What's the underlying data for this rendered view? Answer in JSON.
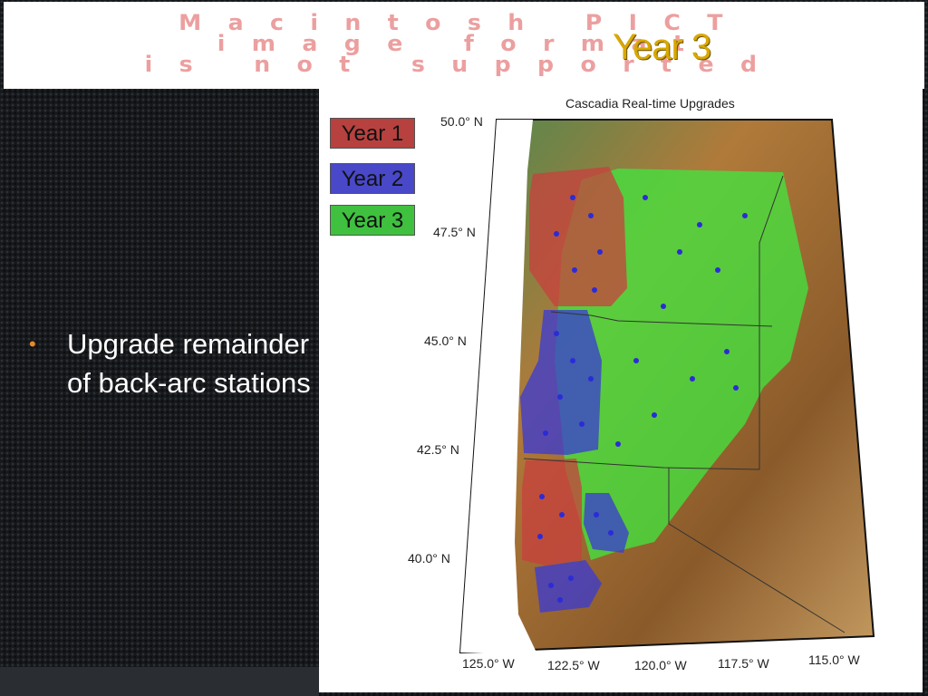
{
  "banner": {
    "pict_line1": "Macintosh PICT",
    "pict_line2": "image format",
    "pict_line3": "is not supported"
  },
  "slide": {
    "title": "Year 3",
    "bullet": "Upgrade remainder of back-arc stations"
  },
  "map": {
    "title": "Cascadia Real-time Upgrades",
    "legend": [
      {
        "label": "Year 1",
        "color": "#b6413e"
      },
      {
        "label": "Year 2",
        "color": "#4848c8"
      },
      {
        "label": "Year 3",
        "color": "#3fc03f"
      }
    ],
    "lat_labels": [
      "50.0° N",
      "47.5° N",
      "45.0° N",
      "42.5° N",
      "40.0° N"
    ],
    "lon_labels": [
      "125.0° W",
      "122.5° W",
      "120.0° W",
      "117.5° W",
      "115.0° W"
    ],
    "colors": {
      "year1": "#c8403e",
      "year2": "#3a3ad6",
      "year3": "#3fe83f",
      "station": "#2b2bd8"
    }
  }
}
